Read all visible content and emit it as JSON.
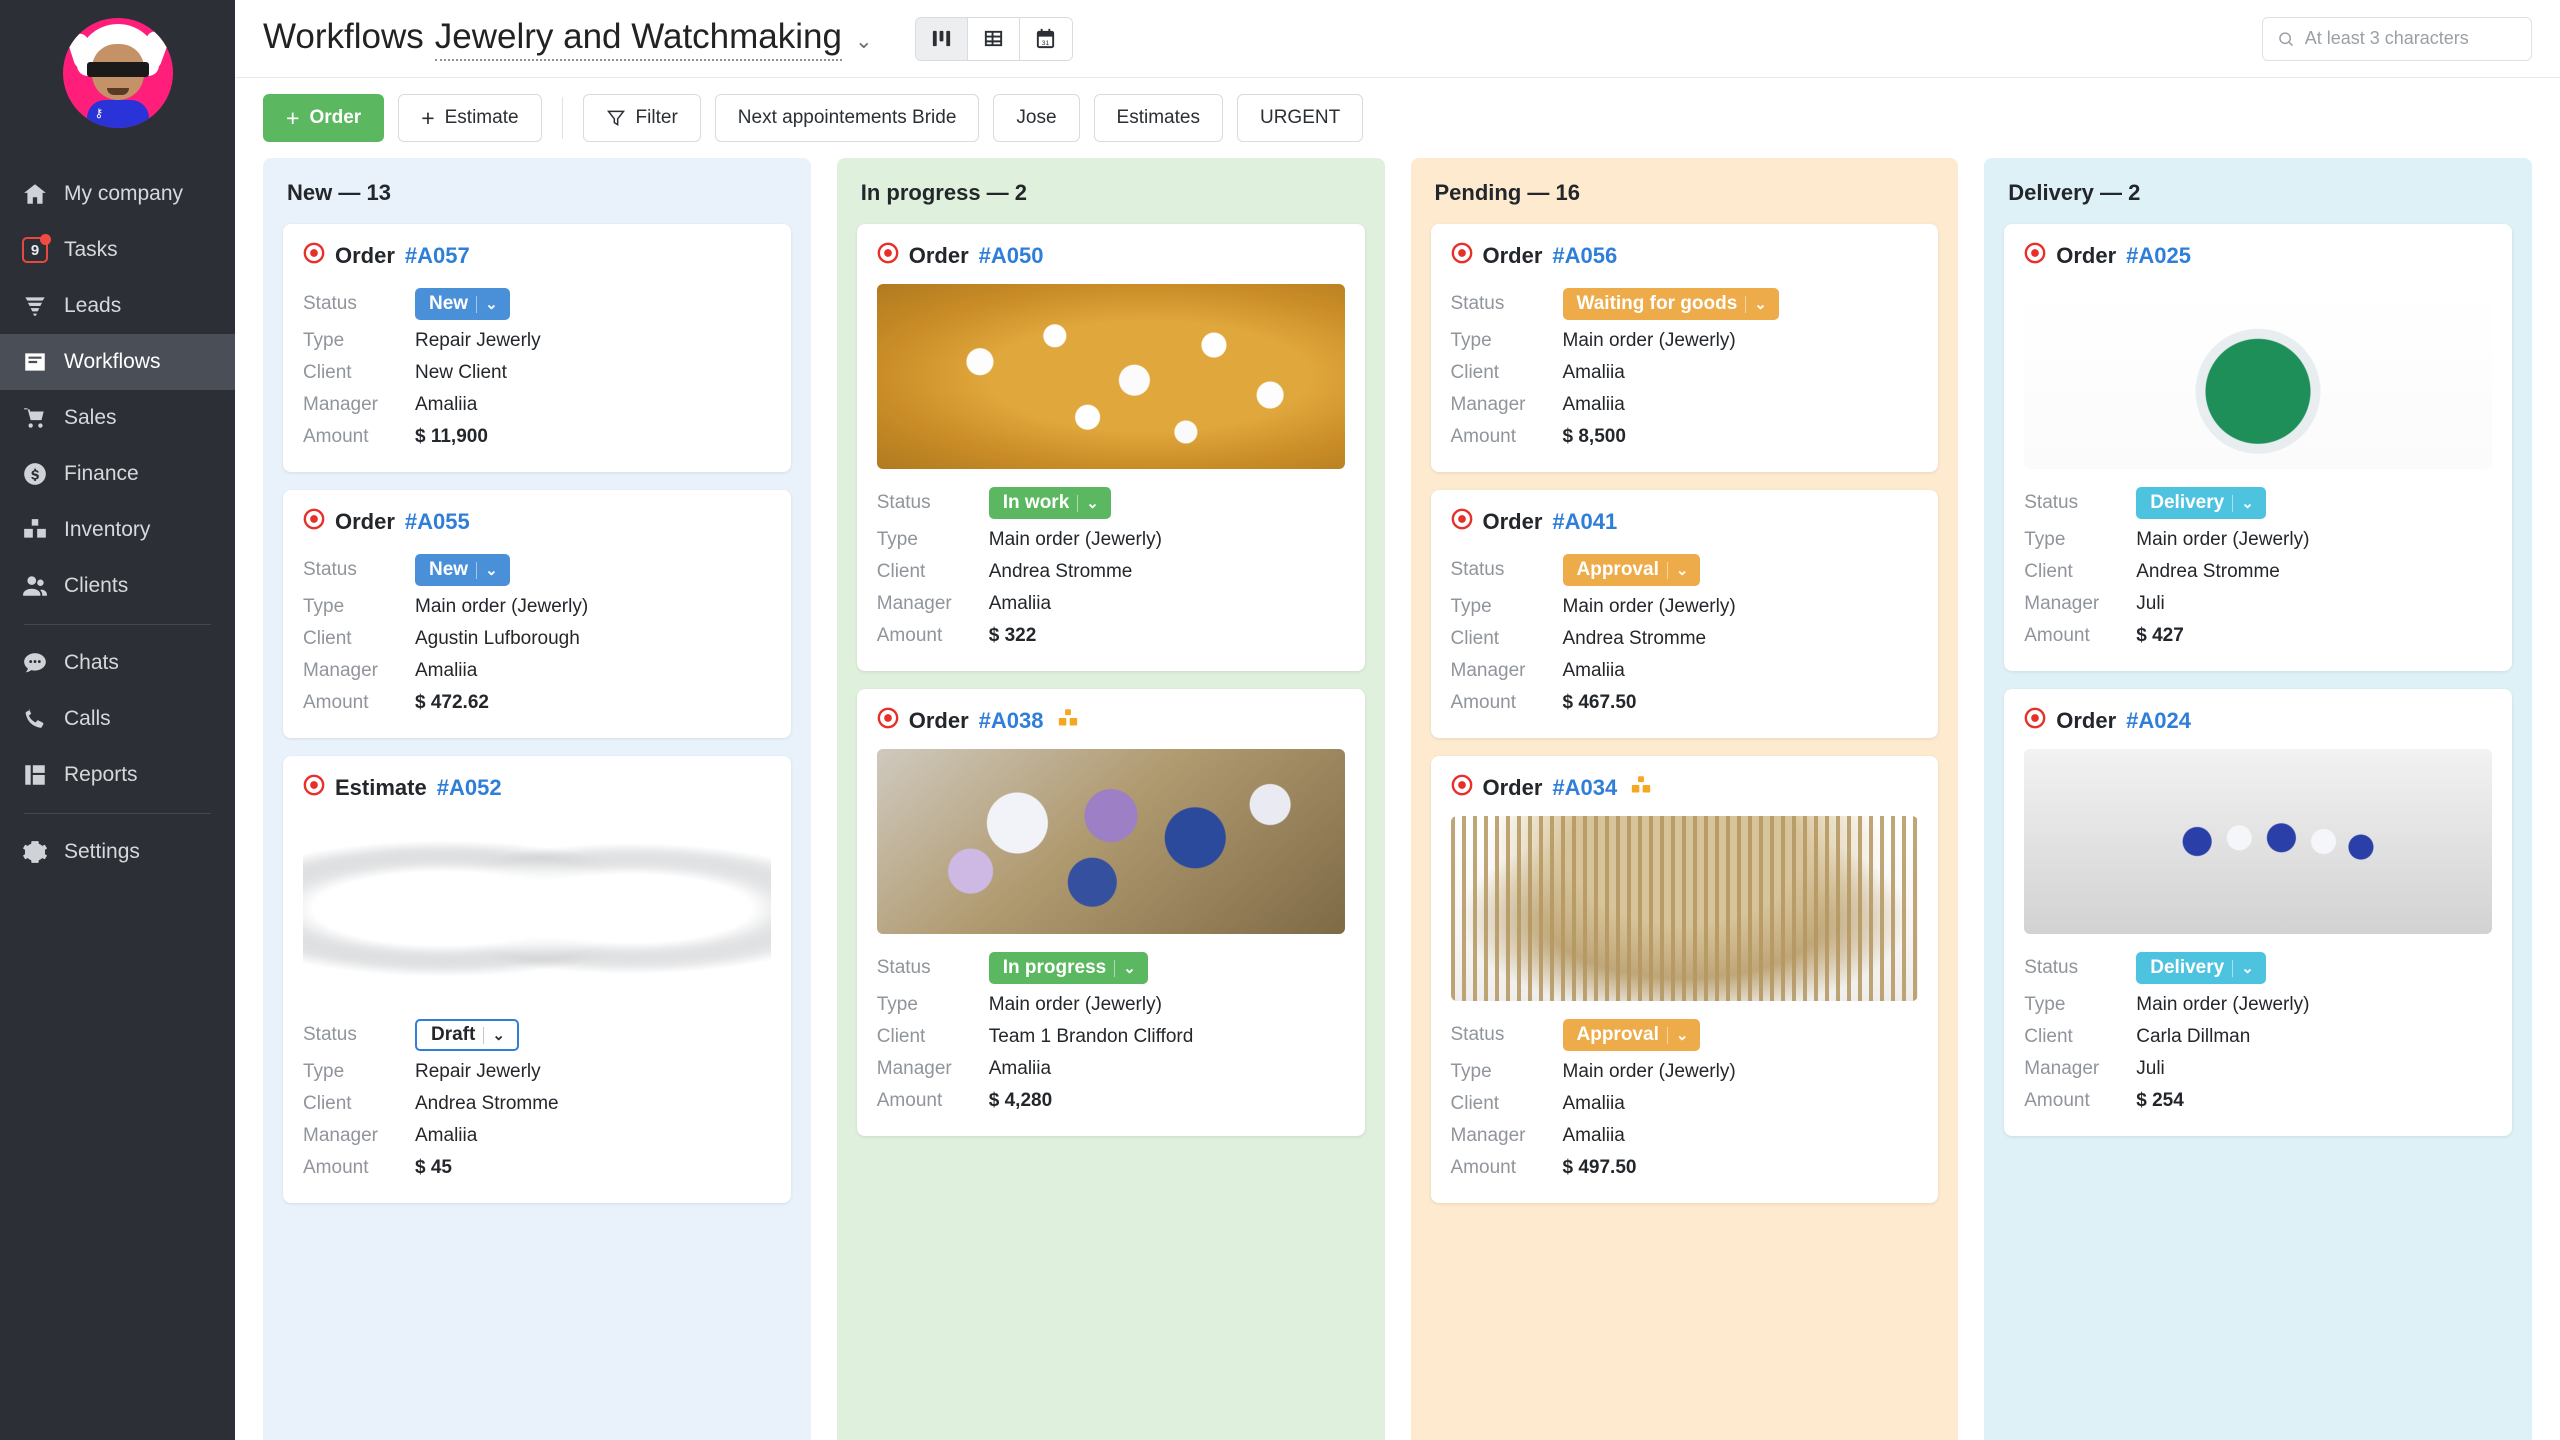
{
  "sidebar": {
    "avatar_name": "user-avatar",
    "items": [
      {
        "label": "My company",
        "icon": "home-icon",
        "active": false
      },
      {
        "label": "Tasks",
        "icon": "tasks-badge-icon",
        "active": false,
        "badge": "9"
      },
      {
        "label": "Leads",
        "icon": "funnel-icon",
        "active": false
      },
      {
        "label": "Workflows",
        "icon": "workflows-icon",
        "active": true
      },
      {
        "label": "Sales",
        "icon": "cart-icon",
        "active": false
      },
      {
        "label": "Finance",
        "icon": "dollar-circle-icon",
        "active": false
      },
      {
        "label": "Inventory",
        "icon": "boxes-icon",
        "active": false
      },
      {
        "label": "Clients",
        "icon": "people-icon",
        "active": false
      },
      {
        "label": "Chats",
        "icon": "chat-bubble-icon",
        "active": false
      },
      {
        "label": "Calls",
        "icon": "phone-icon",
        "active": false
      },
      {
        "label": "Reports",
        "icon": "reports-grid-icon",
        "active": false
      },
      {
        "label": "Settings",
        "icon": "gear-icon",
        "active": false
      }
    ]
  },
  "header": {
    "title_main": "Workflows",
    "title_sub": "Jewelry and Watchmaking",
    "caret": "⌄",
    "views": [
      {
        "name": "kanban-view",
        "icon": "kanban-icon",
        "active": true
      },
      {
        "name": "table-view",
        "icon": "table-icon",
        "active": false
      },
      {
        "name": "calendar-view",
        "icon": "calendar-icon",
        "active": false
      }
    ],
    "search_placeholder": "At least 3 characters",
    "search_value": ""
  },
  "toolbar": {
    "order_label": "Order",
    "estimate_label": "Estimate",
    "filter_label": "Filter",
    "chips": [
      "Next appointements Bride",
      "Jose",
      "Estimates",
      "URGENT"
    ]
  },
  "labels": {
    "status": "Status",
    "type": "Type",
    "client": "Client",
    "manager": "Manager",
    "amount": "Amount"
  },
  "board": {
    "columns": [
      {
        "title": "New — 13",
        "bg": "#e9f2fb",
        "cards": [
          {
            "kind": "Order",
            "number": "#A057",
            "has_inventory_icon": false,
            "image": null,
            "status": "New",
            "status_style": "sb-new",
            "type": "Repair Jewerly",
            "client": "New Client",
            "manager": "Amaliia",
            "amount": "$ 11,900"
          },
          {
            "kind": "Order",
            "number": "#A055",
            "has_inventory_icon": false,
            "image": null,
            "status": "New",
            "status_style": "sb-new",
            "type": "Main order (Jewerly)",
            "client": "Agustin Lufborough",
            "manager": "Amaliia",
            "amount": "$ 472.62"
          },
          {
            "kind": "Estimate",
            "number": "#A052",
            "has_inventory_icon": false,
            "image": "img-earrings",
            "status": "Draft",
            "status_style": "outline",
            "type": "Repair Jewerly",
            "client": "Andrea Stromme",
            "manager": "Amaliia",
            "amount": "$ 45"
          }
        ]
      },
      {
        "title": "In progress — 2",
        "bg": "#dff0dc",
        "cards": [
          {
            "kind": "Order",
            "number": "#A050",
            "has_inventory_icon": false,
            "image": "img-gold",
            "status": "In work",
            "status_style": "sb-green",
            "type": "Main order (Jewerly)",
            "client": "Andrea Stromme",
            "manager": "Amaliia",
            "amount": "$ 322"
          },
          {
            "kind": "Order",
            "number": "#A038",
            "has_inventory_icon": true,
            "image": "img-gems",
            "status": "In progress",
            "status_style": "sb-green",
            "type": "Main order (Jewerly)",
            "client": "Team 1 Brandon Clifford",
            "manager": "Amaliia",
            "amount": "$ 4,280"
          }
        ]
      },
      {
        "title": "Pending — 16",
        "bg": "#fdeacf",
        "cards": [
          {
            "kind": "Order",
            "number": "#A056",
            "has_inventory_icon": false,
            "image": null,
            "status": "Waiting for goods",
            "status_style": "sb-orange",
            "type": "Main order (Jewerly)",
            "client": "Amaliia",
            "manager": "Amaliia",
            "amount": "$ 8,500"
          },
          {
            "kind": "Order",
            "number": "#A041",
            "has_inventory_icon": false,
            "image": null,
            "status": "Approval",
            "status_style": "sb-orange",
            "type": "Main order (Jewerly)",
            "client": "Andrea Stromme",
            "manager": "Amaliia",
            "amount": "$ 467.50"
          },
          {
            "kind": "Order",
            "number": "#A034",
            "has_inventory_icon": true,
            "image": "img-necklace",
            "status": "Approval",
            "status_style": "sb-orange",
            "type": "Main order (Jewerly)",
            "client": "Amaliia",
            "manager": "Amaliia",
            "amount": "$ 497.50"
          }
        ]
      },
      {
        "title": "Delivery — 2",
        "bg": "#def1f7",
        "cards": [
          {
            "kind": "Order",
            "number": "#A025",
            "has_inventory_icon": false,
            "image": "img-pendant",
            "status": "Delivery",
            "status_style": "sb-cyan",
            "type": "Main order (Jewerly)",
            "client": "Andrea Stromme",
            "manager": "Juli",
            "amount": "$ 427"
          },
          {
            "kind": "Order",
            "number": "#A024",
            "has_inventory_icon": false,
            "image": "img-ring",
            "status": "Delivery",
            "status_style": "sb-cyan",
            "type": "Main order (Jewerly)",
            "client": "Carla Dillman",
            "manager": "Juli",
            "amount": "$ 254"
          }
        ]
      }
    ]
  }
}
